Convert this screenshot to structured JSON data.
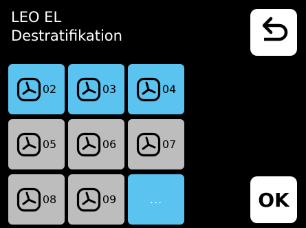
{
  "header": {
    "line1": "LEO EL",
    "line2": "Destratifikation"
  },
  "buttons": {
    "back_icon": "back-arrow-icon",
    "ok_label": "OK"
  },
  "tiles": [
    {
      "label": "02",
      "selected": true,
      "icon": "fan-icon"
    },
    {
      "label": "03",
      "selected": true,
      "icon": "fan-icon"
    },
    {
      "label": "04",
      "selected": true,
      "icon": "fan-icon"
    },
    {
      "label": "05",
      "selected": false,
      "icon": "fan-icon"
    },
    {
      "label": "06",
      "selected": false,
      "icon": "fan-icon"
    },
    {
      "label": "07",
      "selected": false,
      "icon": "fan-icon"
    },
    {
      "label": "08",
      "selected": false,
      "icon": "fan-icon"
    },
    {
      "label": "09",
      "selected": false,
      "icon": "fan-icon"
    }
  ],
  "more_tile": {
    "label": "...",
    "selected": true
  },
  "colors": {
    "background": "#000000",
    "selected": "#5ac3f0",
    "unselected": "#bdbdbd",
    "button": "#ffffff"
  }
}
